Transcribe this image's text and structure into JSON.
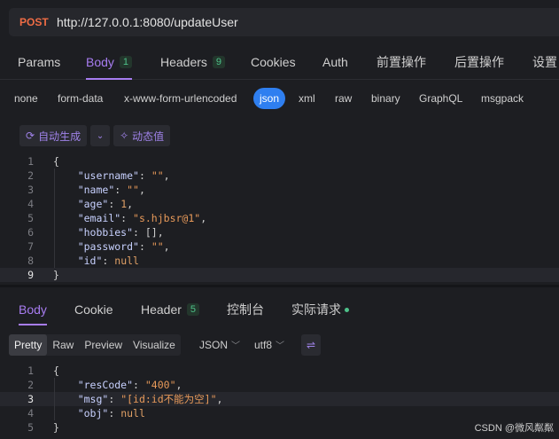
{
  "request": {
    "method": "POST",
    "url": "http://127.0.0.1:8080/updateUser"
  },
  "req_tabs": [
    {
      "label": "Params"
    },
    {
      "label": "Body",
      "count": "1"
    },
    {
      "label": "Headers",
      "count": "9"
    },
    {
      "label": "Cookies"
    },
    {
      "label": "Auth"
    },
    {
      "label": "前置操作"
    },
    {
      "label": "后置操作"
    },
    {
      "label": "设置"
    }
  ],
  "body_types": [
    "none",
    "form-data",
    "x-www-form-urlencoded",
    "json",
    "xml",
    "raw",
    "binary",
    "GraphQL",
    "msgpack"
  ],
  "body_type_selected": "json",
  "gen_bar": {
    "auto_label": "自动生成",
    "dynamic_label": "动态值"
  },
  "request_body_lines": [
    {
      "n": "1",
      "text": "{"
    },
    {
      "n": "2",
      "key": "\"username\"",
      "value": "\"\"",
      "vtype": "s",
      "tail": ","
    },
    {
      "n": "3",
      "key": "\"name\"",
      "value": "\"\"",
      "vtype": "s",
      "tail": ","
    },
    {
      "n": "4",
      "key": "\"age\"",
      "value": "1",
      "vtype": "n",
      "tail": ","
    },
    {
      "n": "5",
      "key": "\"email\"",
      "value": "\"s.hjbsr@1\"",
      "vtype": "s",
      "tail": ","
    },
    {
      "n": "6",
      "key": "\"hobbies\"",
      "value": "[]",
      "vtype": "p",
      "tail": ","
    },
    {
      "n": "7",
      "key": "\"password\"",
      "value": "\"\"",
      "vtype": "s",
      "tail": ","
    },
    {
      "n": "8",
      "key": "\"id\"",
      "value": "null",
      "vtype": "n",
      "tail": ""
    },
    {
      "n": "9",
      "text": "}",
      "active": true
    }
  ],
  "res_tabs": [
    {
      "label": "Body"
    },
    {
      "label": "Cookie"
    },
    {
      "label": "Header",
      "count": "5"
    },
    {
      "label": "控制台"
    },
    {
      "label": "实际请求"
    }
  ],
  "response_formats": [
    "Pretty",
    "Raw",
    "Preview",
    "Visualize"
  ],
  "response_format_selected": "Pretty",
  "response_lang": "JSON",
  "response_encoding": "utf8",
  "response_body_lines": [
    {
      "n": "1",
      "text": "{"
    },
    {
      "n": "2",
      "key": "\"resCode\"",
      "value": "\"400\"",
      "vtype": "s",
      "tail": ","
    },
    {
      "n": "3",
      "key": "\"msg\"",
      "value": "\"[id:id不能为空]\"",
      "vtype": "s",
      "tail": ",",
      "active": true
    },
    {
      "n": "4",
      "key": "\"obj\"",
      "value": "null",
      "vtype": "n",
      "tail": ""
    },
    {
      "n": "5",
      "text": "}"
    }
  ],
  "watermark": "CSDN @微风粼粼",
  "colors": {
    "accent": "#a77cf0",
    "method": "#ef6c45",
    "selected_pill": "#2f7ff0",
    "count_badge": "#4ec28a"
  },
  "icons": {
    "auto_generate": "refresh-icon",
    "dynamic_value": "magic-wand-icon",
    "wrap": "wrap-lines-icon"
  }
}
